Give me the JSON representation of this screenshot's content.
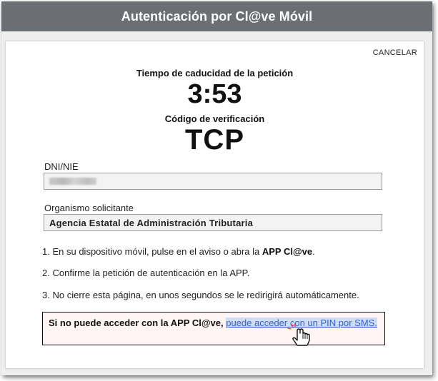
{
  "header": {
    "title": "Autenticación por Cl@ve Móvil"
  },
  "actions": {
    "cancel_label": "CANCELAR"
  },
  "timer": {
    "label": "Tiempo de caducidad de la petición",
    "value": "3:53"
  },
  "verification": {
    "label": "Código de verificación",
    "code": "TCP"
  },
  "fields": {
    "dni_label": "DNI/NIE",
    "dni_value": "",
    "org_label": "Organismo solicitante",
    "org_value": "Agencia Estatal de Administración Tributaria"
  },
  "steps": [
    {
      "number": "1.",
      "text": "En su dispositivo móvil, pulse en el aviso o abra la ",
      "bold": "APP Cl@ve",
      "suffix": "."
    },
    {
      "number": "2.",
      "text": "Confirme la petición de autenticación en la APP."
    },
    {
      "number": "3.",
      "text": "No cierre esta página, en unos segundos se le redirigirá automáticamente."
    }
  ],
  "notice": {
    "text": "Si no puede acceder con la APP Cl@ve,",
    "link": "puede acceder con un PIN por SMS."
  },
  "icons": {
    "cursor": "hand-pointer-icon"
  }
}
